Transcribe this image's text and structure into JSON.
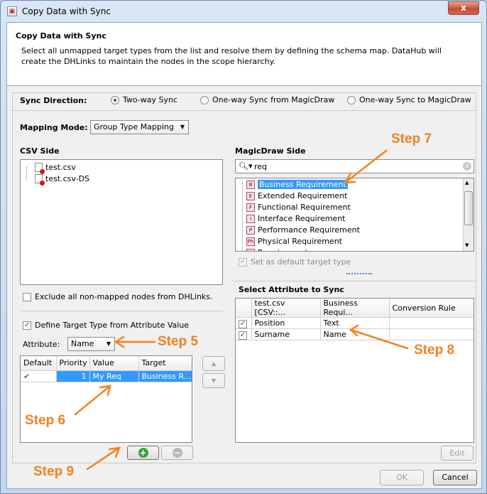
{
  "window": {
    "title": "Copy Data with Sync",
    "close_glyph": "x"
  },
  "banner": {
    "title": "Copy Data with Sync",
    "description": "Select all unmapped target types from the list and resolve them by defining the schema map. DataHub will create the DHLinks to maintain the nodes in the scope hierarchy."
  },
  "sync": {
    "label": "Sync Direction:",
    "options": [
      "Two-way Sync",
      "One-way Sync from MagicDraw",
      "One-way Sync to MagicDraw"
    ],
    "selected_index": 0
  },
  "mapping": {
    "label": "Mapping Mode:",
    "value": "Group Type Mapping"
  },
  "csv_side": {
    "label": "CSV Side",
    "items": [
      "test.csv",
      "test.csv-DS"
    ]
  },
  "exclude": {
    "label": "Exclude all non-mapped nodes from DHLinks.",
    "checked": false
  },
  "define_target": {
    "label": "Define Target Type from Attribute Value",
    "checked": true
  },
  "attribute": {
    "label": "Attribute:",
    "value": "Name"
  },
  "mapping_table": {
    "columns": [
      "Default",
      "Priority",
      "Value",
      "Target"
    ],
    "rows": [
      {
        "default": "check",
        "priority": "1",
        "value": "My Req",
        "target": "Business R..."
      }
    ]
  },
  "magicdraw_side": {
    "label": "MagicDraw Side",
    "search_value": "req",
    "items": [
      {
        "badge": "B",
        "label": "Business Requirement",
        "selected": true
      },
      {
        "badge": "E",
        "label": "Extended Requirement"
      },
      {
        "badge": "F",
        "label": "Functional Requirement"
      },
      {
        "badge": "I",
        "label": "Interface Requirement"
      },
      {
        "badge": "P",
        "label": "Performance Requirement"
      },
      {
        "badge": "Ph",
        "label": "Physical Requirement"
      },
      {
        "badge": "R",
        "label": "Requirement"
      }
    ]
  },
  "default_target": {
    "label": "Set as default target type",
    "checked": true,
    "enabled": false
  },
  "attr_sync": {
    "label": "Select Attribute to Sync",
    "columns": [
      "",
      "test.csv [CSV::...",
      "Business Requi...",
      "Conversion Rule"
    ],
    "rows": [
      {
        "checked": true,
        "source": "Position",
        "target": "Text",
        "rule": ""
      },
      {
        "checked": true,
        "source": "Surname",
        "target": "Name",
        "rule": ""
      }
    ]
  },
  "buttons": {
    "edit": "Edit",
    "ok": "OK",
    "cancel": "Cancel",
    "add_glyph": "+",
    "remove_glyph": "−",
    "up_glyph": "▲",
    "down_glyph": "▼"
  },
  "steps": [
    "Step 5",
    "Step 6",
    "Step 7",
    "Step 8",
    "Step 9"
  ],
  "colors": {
    "step_annotation": "#f4801f",
    "selection": "#3399ff"
  }
}
